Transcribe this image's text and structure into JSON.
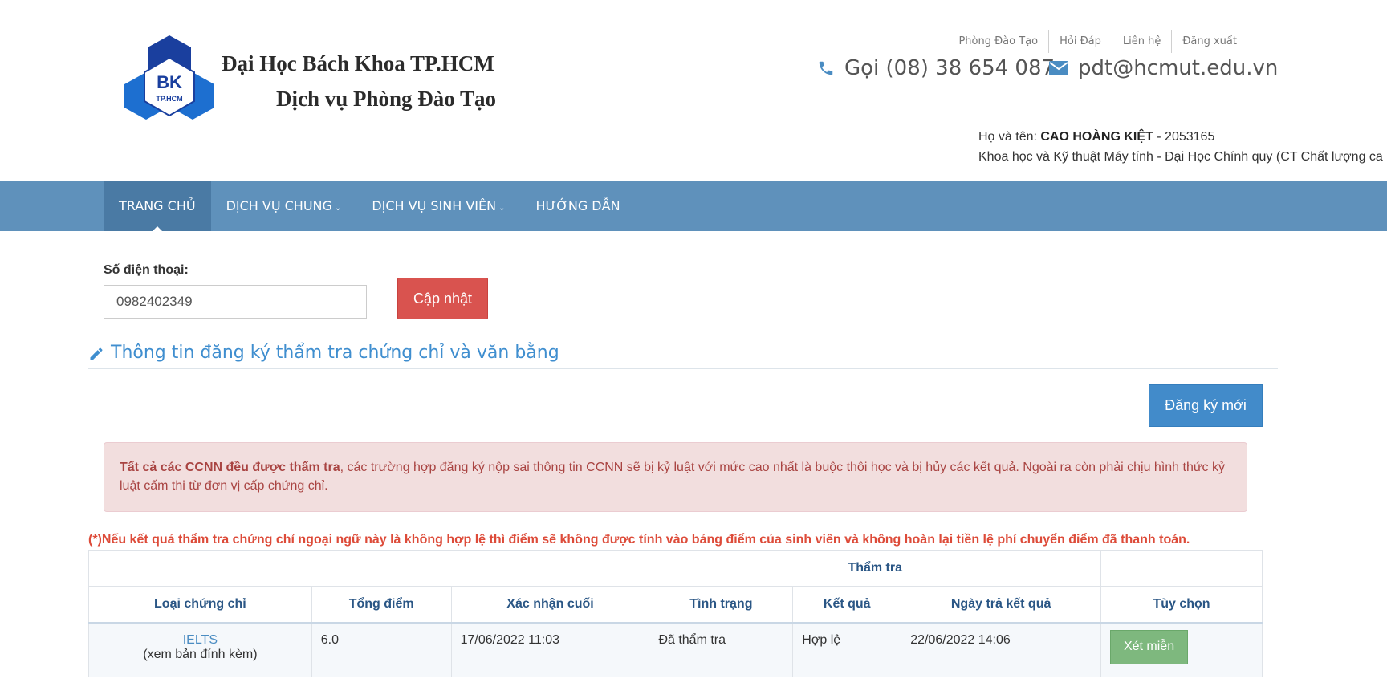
{
  "header": {
    "brand_line1": "Đại Học Bách Khoa TP.HCM",
    "brand_line2": "Dịch vụ Phòng Đào Tạo",
    "logo_top": "BK",
    "logo_bottom": "TP.HCM",
    "toplinks": [
      "Phòng Đào Tạo",
      "Hỏi Đáp",
      "Liên hệ",
      "Đăng xuất"
    ],
    "phone": "Gọi (08) 38 654 087",
    "email": "pdt@hcmut.edu.vn",
    "user_label": "Họ và tên: ",
    "user_name": "CAO HOÀNG KIỆT",
    "user_id": " - 2053165",
    "user_faculty": "Khoa học và Kỹ thuật Máy tính - Đại Học Chính quy (CT Chất lượng ca"
  },
  "nav": {
    "items": [
      "TRANG CHỦ",
      "DỊCH VỤ CHUNG",
      "DỊCH VỤ SINH VIÊN",
      "HƯỚNG DẪN"
    ]
  },
  "phone_form": {
    "label": "Số điện thoại:",
    "value": "0982402349",
    "update_button": "Cập nhật"
  },
  "section": {
    "title": "Thông tin đăng ký thẩm tra chứng chỉ và văn bằng",
    "register_button": "Đăng ký mới"
  },
  "alert": {
    "bold": "Tất cả các CCNN đều được thẩm tra",
    "text": ", các trường hợp đăng ký nộp sai thông tin CCNN sẽ bị kỷ luật với mức cao nhất là buộc thôi học và bị hủy các kết quả. Ngoài ra còn phải chịu hình thức kỷ luật cấm thi từ đơn vị cấp chứng chỉ."
  },
  "note": "(*)Nếu kết quả thẩm tra chứng chỉ ngoại ngữ này là không hợp lệ thì điểm sẽ không được tính vào bảng điểm của sinh viên và không hoàn lại tiền lệ phí chuyển điểm đã thanh toán.",
  "table": {
    "group_header": "Thẩm tra",
    "columns": [
      "Loại chứng chỉ",
      "Tổng điểm",
      "Xác nhận cuối",
      "Tình trạng",
      "Kết quả",
      "Ngày trả kết quả",
      "Tùy chọn"
    ],
    "rows": [
      {
        "cert": "IELTS",
        "cert_note": "(xem bản đính kèm)",
        "score": "6.0",
        "confirmed": "17/06/2022 11:03",
        "status": "Đã thẩm tra",
        "result": "Hợp lệ",
        "result_date": "22/06/2022 14:06",
        "action": "Xét miễn"
      }
    ]
  },
  "colors": {
    "nav_bg": "#5f91bb",
    "nav_active": "#4a7aa4",
    "danger": "#d9534f",
    "primary": "#428bca",
    "success": "#7eb87e"
  }
}
